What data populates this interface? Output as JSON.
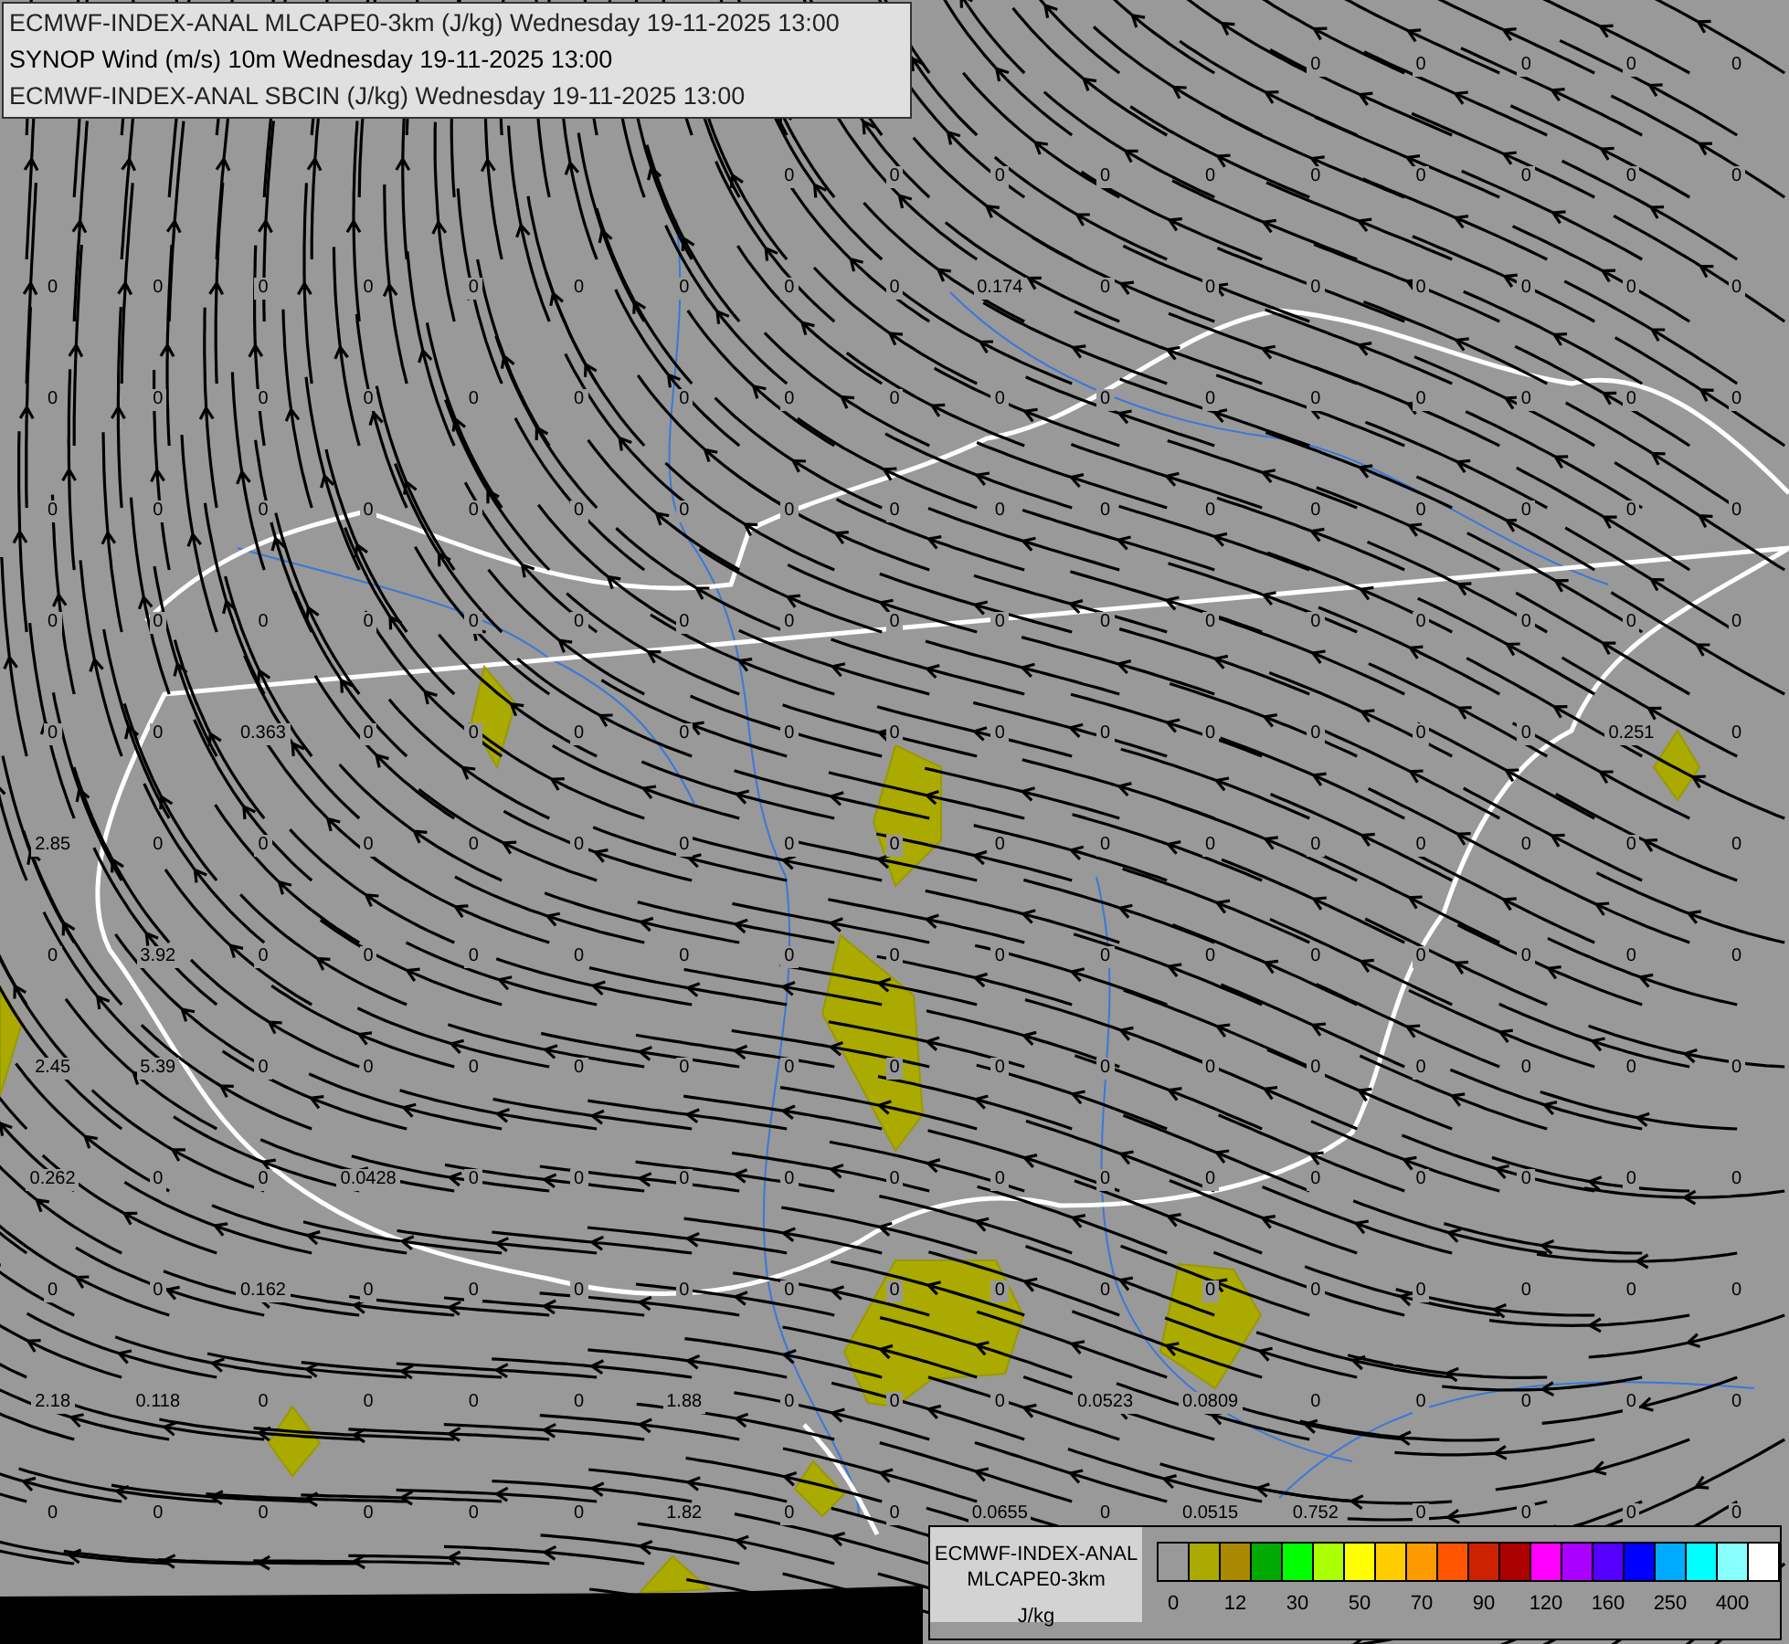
{
  "header": {
    "lines": [
      "ECMWF-INDEX-ANAL MLCAPE0-3km (J/kg) Wednesday 19-11-2025 13:00",
      "SYNOP Wind (m/s) 10m Wednesday 19-11-2025 13:00",
      "ECMWF-INDEX-ANAL SBCIN (J/kg) Wednesday 19-11-2025 13:00"
    ]
  },
  "value_grid": [
    [
      "0",
      "0",
      "0",
      "0",
      "0"
    ],
    [
      "0",
      "0",
      "0",
      "0",
      "0",
      "0",
      "0",
      "0",
      "0",
      "0"
    ],
    [
      "0",
      "0",
      "0",
      "0",
      "0",
      "0",
      "0",
      "0",
      "0",
      "0.174",
      "0",
      "0",
      "0",
      "0",
      "0",
      "0",
      "0"
    ],
    [
      "0",
      "0",
      "0",
      "0",
      "0",
      "0",
      "0",
      "0",
      "0",
      "0",
      "0",
      "0",
      "0",
      "0",
      "0",
      "0",
      "0"
    ],
    [
      "0",
      "0",
      "0",
      "0",
      "0",
      "0",
      "0",
      "0",
      "0",
      "0",
      "0",
      "0",
      "0",
      "0",
      "0",
      "0",
      "0"
    ],
    [
      "0",
      "0",
      "0",
      "0",
      "0",
      "0",
      "0",
      "0",
      "0",
      "0",
      "0",
      "0",
      "0",
      "0",
      "0",
      "0",
      "0"
    ],
    [
      "0",
      "0",
      "0.363",
      "0",
      "0",
      "0",
      "0",
      "0",
      "0",
      "0",
      "0",
      "0",
      "0",
      "0",
      "0",
      "0.251",
      "0"
    ],
    [
      "2.85",
      "0",
      "0",
      "0",
      "0",
      "0",
      "0",
      "0",
      "0",
      "0",
      "0",
      "0",
      "0",
      "0",
      "0",
      "0",
      "0"
    ],
    [
      "0",
      "3.92",
      "0",
      "0",
      "0",
      "0",
      "0",
      "0",
      "0",
      "0",
      "0",
      "0",
      "0",
      "0",
      "0",
      "0",
      "0"
    ],
    [
      "2.45",
      "5.39",
      "0",
      "0",
      "0",
      "0",
      "0",
      "0",
      "0",
      "0",
      "0",
      "0",
      "0",
      "0",
      "0",
      "0",
      "0"
    ],
    [
      "0.262",
      "0",
      "0",
      "0.0428",
      "0",
      "0",
      "0",
      "0",
      "0",
      "0",
      "0",
      "0",
      "0",
      "0",
      "0",
      "0",
      "0"
    ],
    [
      "0",
      "0",
      "0.162",
      "0",
      "0",
      "0",
      "0",
      "0",
      "0",
      "0",
      "0",
      "0",
      "0",
      "0",
      "0",
      "0",
      "0"
    ],
    [
      "2.18",
      "0.118",
      "0",
      "0",
      "0",
      "0",
      "1.88",
      "0",
      "0",
      "0",
      "0.0523",
      "0.0809",
      "0",
      "0",
      "0",
      "0",
      "0"
    ],
    [
      "0",
      "0",
      "0",
      "0",
      "0",
      "0",
      "1.82",
      "0",
      "0",
      "0.0655",
      "0",
      "0.0515",
      "0.752",
      "0",
      "0",
      "0",
      "0"
    ]
  ],
  "legend": {
    "title": [
      "ECMWF-INDEX-ANAL",
      "MLCAPE0-3km"
    ],
    "unit": "J/kg",
    "swatches": [
      {
        "color": "#999999"
      },
      {
        "color": "#aaaa00"
      },
      {
        "color": "#aa8800"
      },
      {
        "color": "#00aa00"
      },
      {
        "color": "#00ff00"
      },
      {
        "color": "#aaff00"
      },
      {
        "color": "#ffff00"
      },
      {
        "color": "#ffcc00"
      },
      {
        "color": "#ff9900"
      },
      {
        "color": "#ff5500"
      },
      {
        "color": "#cc2200"
      },
      {
        "color": "#aa0000"
      },
      {
        "color": "#ff00ff"
      },
      {
        "color": "#aa00ff"
      },
      {
        "color": "#5500ff"
      },
      {
        "color": "#0000ff"
      },
      {
        "color": "#00aaff"
      },
      {
        "color": "#00ffff"
      },
      {
        "color": "#88ffff"
      },
      {
        "color": "#ffffff"
      }
    ],
    "ticks": [
      "0",
      "12",
      "30",
      "50",
      "70",
      "90",
      "120",
      "160",
      "250",
      "400"
    ]
  }
}
